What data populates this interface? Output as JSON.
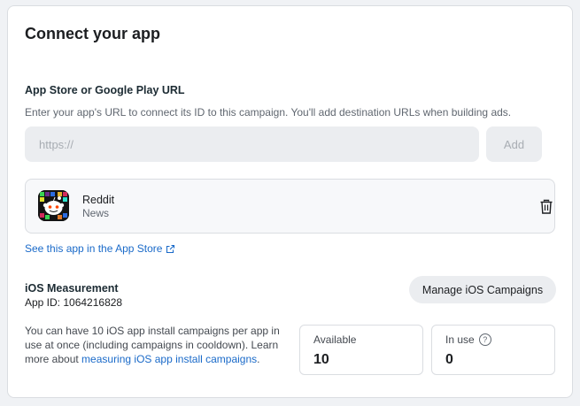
{
  "card": {
    "title": "Connect your app"
  },
  "url_section": {
    "label": "App Store or Google Play URL",
    "help": "Enter your app's URL to connect its ID to this campaign. You'll add destination URLs when building ads.",
    "input_placeholder": "https://",
    "input_value": "",
    "add_label": "Add"
  },
  "app": {
    "name": "Reddit",
    "category": "News",
    "icon": "reddit-app-icon",
    "remove_icon": "trash-icon",
    "store_link": "See this app in the App Store",
    "store_link_icon": "external-link-icon"
  },
  "ios": {
    "title": "iOS Measurement",
    "app_id": "App ID: 1064216828",
    "manage_label": "Manage iOS Campaigns",
    "info_text": "You can have 10 iOS app install campaigns per app in use at once (including campaigns in cooldown). Learn more about ",
    "info_link": "measuring iOS app install campaigns",
    "info_end": ".",
    "available_label": "Available",
    "available_value": "10",
    "inuse_label": "In use",
    "inuse_value": "0",
    "help_icon": "question-circle-icon"
  },
  "colors": {
    "link": "#1a6ac9",
    "input_bg": "#ebedf0",
    "border": "#dadde1"
  }
}
